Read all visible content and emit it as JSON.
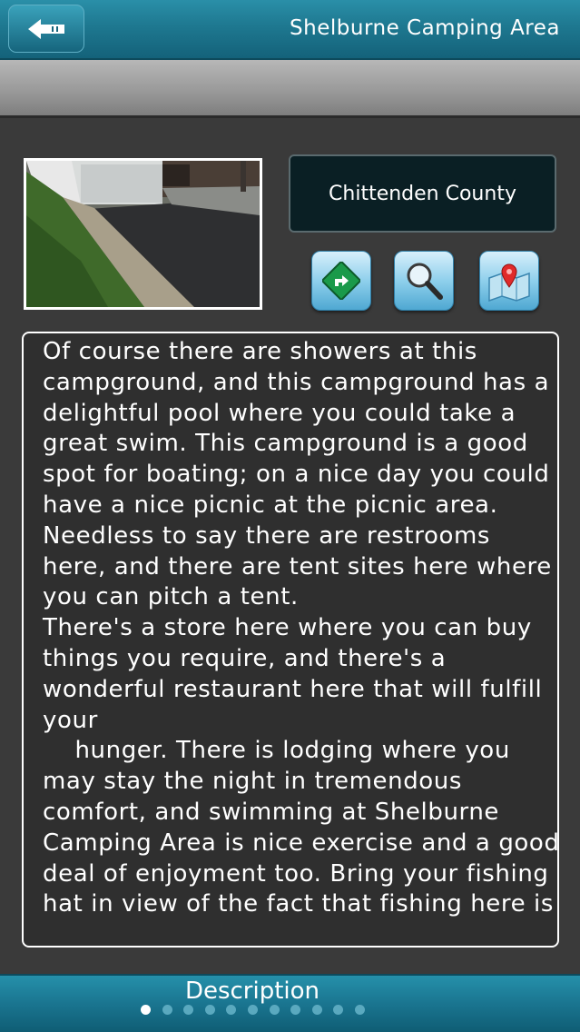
{
  "header": {
    "title": "Shelburne Camping Area",
    "back_icon": "back-arrow-icon"
  },
  "info": {
    "county": "Chittenden County"
  },
  "actions": [
    {
      "icon": "directions-sign-icon"
    },
    {
      "icon": "magnifier-icon"
    },
    {
      "icon": "map-pin-icon"
    }
  ],
  "description": {
    "lines": [
      "Of course there are showers at this",
      "campground, and this campground has a",
      "delightful pool where you could take a",
      "great swim. This campground is a good",
      "spot for boating; on a nice day you could",
      "have a nice picnic at the picnic area.",
      "Needless to say there are restrooms",
      "here, and there are tent sites here where",
      "you can pitch a tent.",
      "There's a store here where you can buy",
      "things you require, and there's a",
      "wonderful restaurant here that will fulfill",
      "your",
      "    hunger. There is lodging where you",
      "may stay the night in tremendous",
      "comfort, and swimming at Shelburne",
      "Camping Area is nice exercise and a good",
      "deal of enjoyment too. Bring your fishing",
      "hat in view of the fact that fishing here is"
    ]
  },
  "footer": {
    "label": "Description",
    "page_count": 11,
    "active_page": 1
  },
  "colors": {
    "header_teal": "#1e7890",
    "background": "#3a3a3a",
    "county_box": "#0a1f24"
  }
}
